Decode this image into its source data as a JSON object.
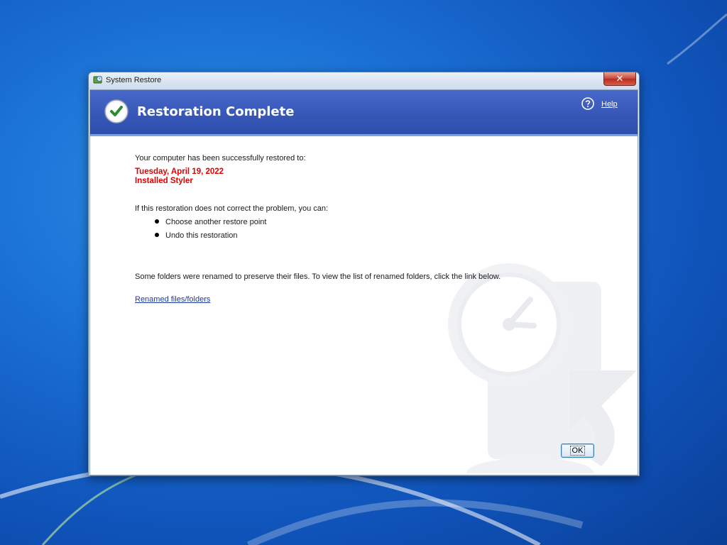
{
  "window": {
    "title": "System Restore",
    "close_glyph": "✕"
  },
  "header": {
    "title": "Restoration Complete",
    "help_label": "Help",
    "background": "#3656b6"
  },
  "content": {
    "restored_intro": "Your computer has been successfully restored to:",
    "restore_date": "Tuesday, April 19, 2022",
    "restore_point_name": "Installed Styler",
    "options_intro": "If this restoration does not correct the problem, you can:",
    "options": [
      "Choose another restore point",
      "Undo this restoration"
    ],
    "renamed_notice": "Some folders were renamed to preserve their files. To view the list of renamed folders, click the link below.",
    "renamed_link": "Renamed files/folders"
  },
  "buttons": {
    "ok": "OK"
  },
  "icons": {
    "title": "system-restore-icon",
    "header": "checkmark-icon",
    "help": "help-icon",
    "watermark": "restore-clock-icon"
  },
  "colors": {
    "accent_red": "#e00000",
    "link": "#1c3b9c"
  }
}
